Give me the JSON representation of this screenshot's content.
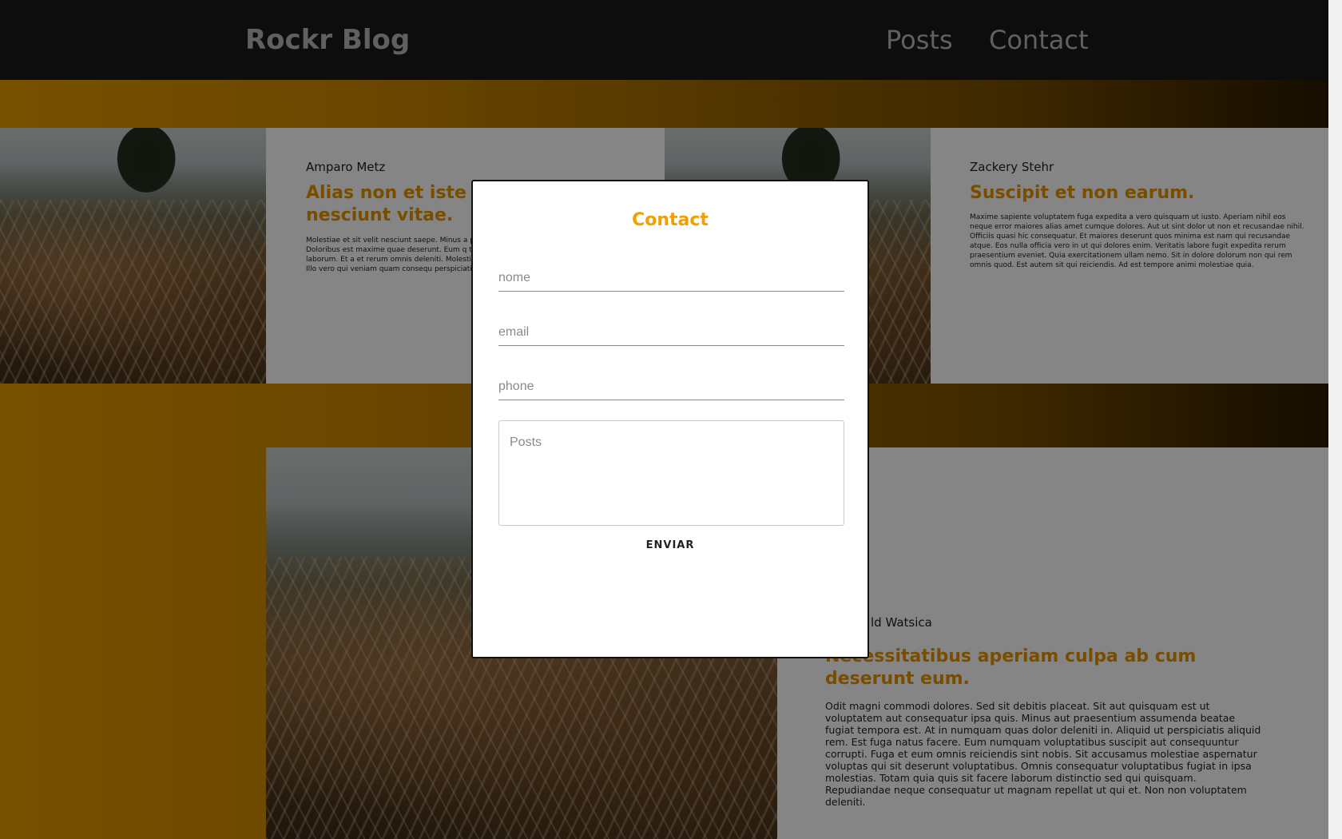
{
  "header": {
    "brand": "Rockr Blog",
    "nav": [
      "Posts",
      "Contact"
    ]
  },
  "posts": [
    {
      "author": "Amparo Metz",
      "title": "Alias non et iste illum iusto nesciunt vitae.",
      "body": "Molestiae et sit velit nesciunt saepe. Minus a possimus. Omnis necessitatibus qui maxime. Doloribus est maxime quae deserunt. Eum q tenetur atque sed sunt eveniet enim. Et occ laborum. Et a et rerum omnis deleniti. Molestiae ratione voluptate provident ex. Ita eveniet. Illo vero qui veniam quam consequ perspiciatis quia. Architecto tempore in et."
    },
    {
      "author": "Zackery Stehr",
      "title": "Suscipit et non earum.",
      "body": "Maxime sapiente voluptatem fuga expedita a vero quisquam ut iusto. Aperiam nihil eos neque error maiores alias amet cumque dolores. Aut ut sint dolor ut non et recusandae nihil. Officiis quasi hic consequatur. Et maiores deserunt quos minima est nam qui recusandae atque. Eos nulla officia vero in ut qui dolores enim. Veritatis labore fugit expedita rerum praesentium eveniet. Quia exercitationem ullam nemo. Sit in dolore dolorum non qui rem omnis quod. Est autem sit qui reiciendis. Ad est tempore animi molestiae quia."
    },
    {
      "author": "ld Watsica",
      "title": "Necessitatibus aperiam culpa ab cum deserunt eum.",
      "body": "Odit magni commodi dolores. Sed sit debitis placeat. Sit aut quisquam est ut voluptatem aut consequatur ipsa quis. Minus aut praesentium assumenda beatae fugiat tempora est. At in numquam quas dolor deleniti in. Aliquid ut perspiciatis aliquid rem. Est fuga natus facere. Eum numquam voluptatibus suscipit aut consequuntur corrupti. Fuga et eum omnis reiciendis sint nobis. Sit accusamus molestiae aspernatur voluptas qui sit deserunt voluptatibus. Omnis consequatur voluptatibus fugiat in ipsa molestias. Totam quia quis sit facere laborum distinctio sed qui quisquam. Repudiandae neque consequatur ut magnam repellat ut qui et. Non non voluptatem deleniti."
    }
  ],
  "modal": {
    "title": "Contact",
    "name_placeholder": "nome",
    "email_placeholder": "email",
    "phone_placeholder": "phone",
    "message_placeholder": "Posts",
    "send_label": "ENVIAR"
  },
  "colors": {
    "accent": "#f0a000",
    "header_bg": "#1a1a1a"
  }
}
